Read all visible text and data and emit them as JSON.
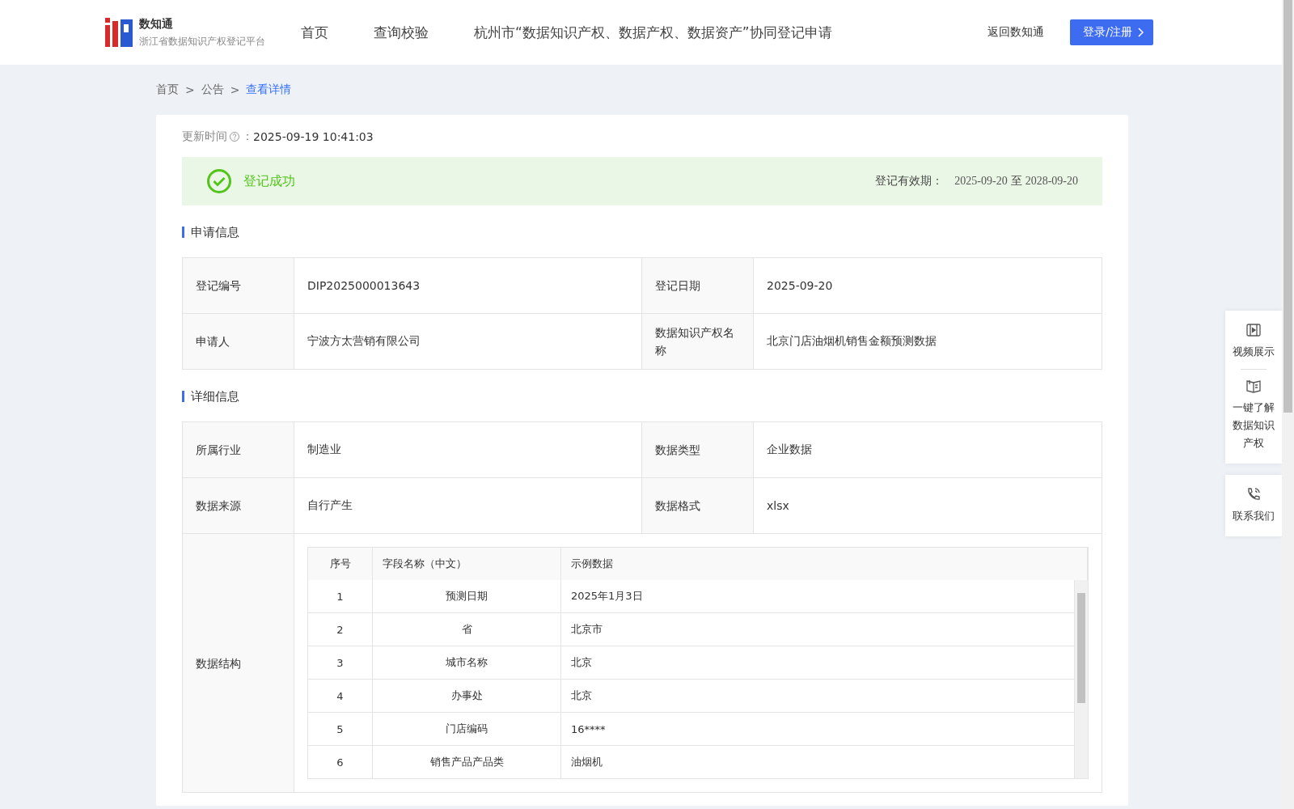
{
  "header": {
    "logo_title": "数知通",
    "logo_subtitle": "浙江省数据知识产权登记平台",
    "nav": [
      {
        "label": "首页",
        "selected": false
      },
      {
        "label": "查询校验",
        "selected": false
      },
      {
        "label": "杭州市“数据知识产权、数据产权、数据资产”协同登记申请",
        "selected": false
      }
    ],
    "back_link": "返回数知通",
    "login_button": "登录/注册"
  },
  "breadcrumb": [
    {
      "label": "首页",
      "selected": false
    },
    {
      "label": "公告",
      "selected": false
    },
    {
      "label": "查看详情",
      "selected": true
    }
  ],
  "breadcrumb_separator": ">",
  "update": {
    "label": "更新时间",
    "colon": "：",
    "value": "2025-09-19 10:41:03"
  },
  "status": {
    "text": "登记成功",
    "validity_label": "登记有效期：",
    "validity_from": "2025-09-20",
    "validity_to_word": "至",
    "validity_to": "2028-09-20"
  },
  "sections": [
    {
      "title": "申请信息",
      "rows": [
        {
          "cells": [
            {
              "label": "登记编号",
              "value": "DIP2025000013643"
            },
            {
              "label": "登记日期",
              "value": "2025-09-20"
            }
          ]
        },
        {
          "cells": [
            {
              "label": "申请人",
              "value": "宁波方太营销有限公司"
            },
            {
              "label": "数据知识产权名称",
              "value": "北京门店油烟机销售金额预测数据"
            }
          ]
        }
      ]
    },
    {
      "title": "详细信息",
      "rows": [
        {
          "cells": [
            {
              "label": "所属行业",
              "value": "制造业"
            },
            {
              "label": "数据类型",
              "value": "企业数据"
            }
          ]
        },
        {
          "cells": [
            {
              "label": "数据来源",
              "value": "自行产生"
            },
            {
              "label": "数据格式",
              "value": "xlsx"
            }
          ]
        }
      ]
    }
  ],
  "structure": {
    "label": "数据结构",
    "columns": [
      "序号",
      "字段名称（中文）",
      "示例数据"
    ],
    "rows": [
      [
        "1",
        "预测日期",
        "2025年1月3日"
      ],
      [
        "2",
        "省",
        "北京市"
      ],
      [
        "3",
        "城市名称",
        "北京"
      ],
      [
        "4",
        "办事处",
        "北京"
      ],
      [
        "5",
        "门店编码",
        "16****"
      ],
      [
        "6",
        "销售产品产品类",
        "油烟机"
      ]
    ]
  },
  "side_panel": [
    {
      "kind": "video",
      "label": "视频展示"
    },
    {
      "kind": "book",
      "label": "一键了解数据知识产权"
    },
    {
      "kind": "phone",
      "label": "联系我们"
    }
  ]
}
